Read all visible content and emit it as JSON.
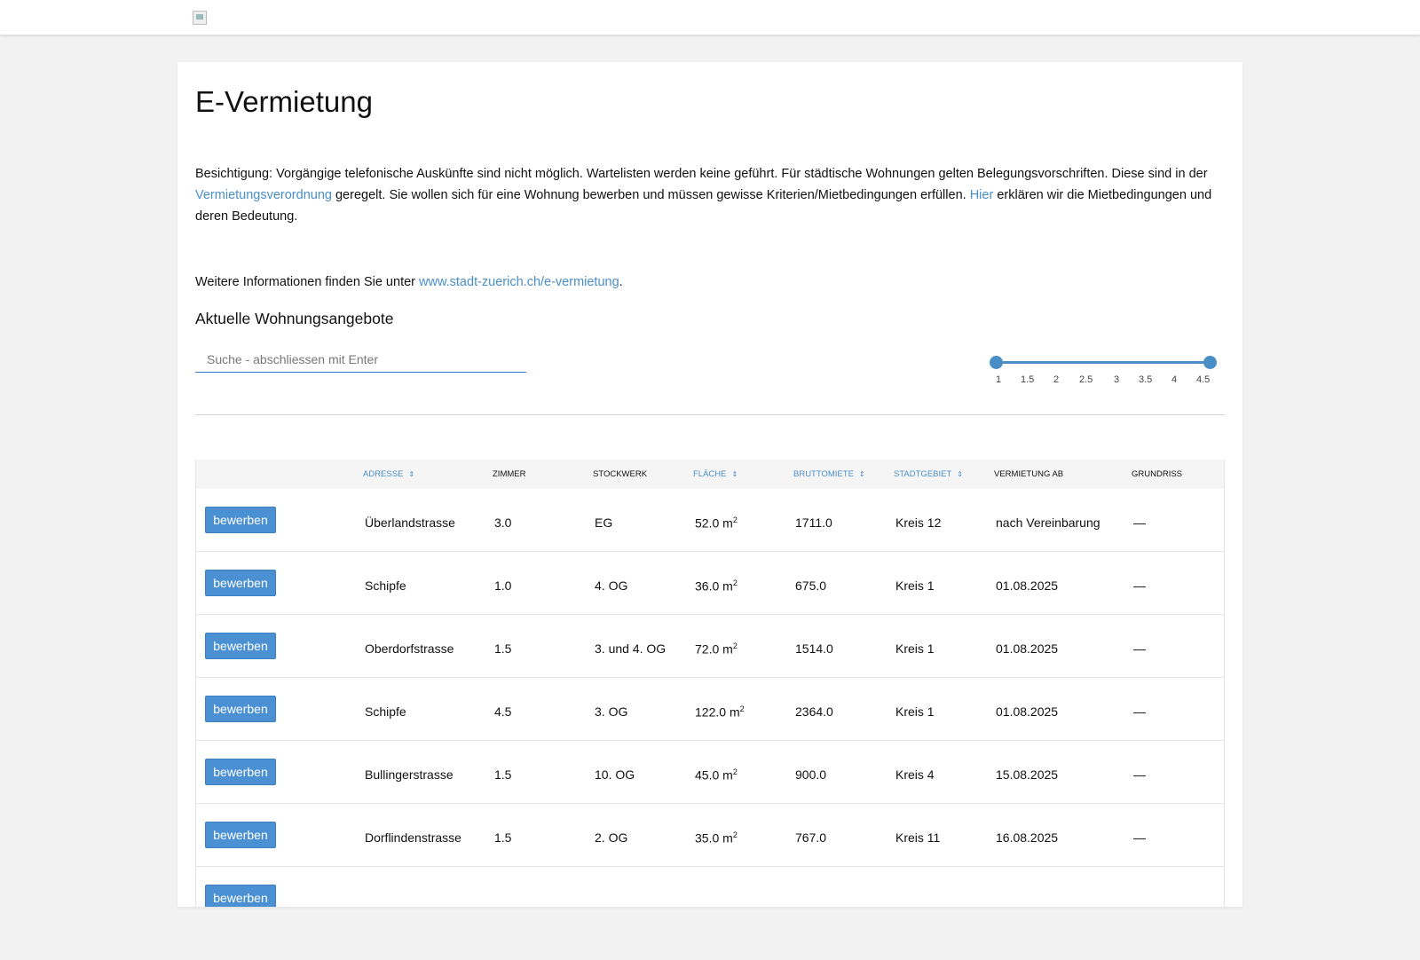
{
  "page": {
    "title": "E-Vermietung",
    "intro_part1": "Besichtigung: Vorgängige telefonische Auskünfte sind nicht möglich. Wartelisten werden keine geführt. Für städtische Wohnungen gelten Belegungsvorschriften. Diese sind in der ",
    "intro_link1": "Vermie­tungsverordnung",
    "intro_part2": " geregelt. Sie wollen sich für eine Wohnung bewerben und müssen gewisse Kriterien/Mietbedingungen erfüllen. ",
    "intro_link2": "Hier",
    "intro_part3": " erklären wir die Mietbedingungen und deren Bedeutung.",
    "more_prefix": "Weitere Informationen finden Sie unter ",
    "more_link": "www.stadt-zuerich.ch/e-vermietung",
    "more_suffix": ".",
    "offers_heading": "Aktuelle Wohnungsangebote"
  },
  "search": {
    "placeholder": "Suche - abschliessen mit Enter",
    "value": ""
  },
  "room_filter": {
    "min": "1",
    "max": "4.5",
    "ticks": [
      "1",
      "1.5",
      "2",
      "2.5",
      "3",
      "3.5",
      "4",
      "4.5"
    ]
  },
  "table": {
    "headers": {
      "adresse": "Adresse",
      "zimmer": "Zimmer",
      "stockwerk": "Stockwerk",
      "flaeche": "Fläche",
      "bruttomiete": "Bruttomiete",
      "stadtgebiet": "Stadtgebiet",
      "vermietung_ab": "Vermietung ab",
      "grundriss": "Grundriss"
    },
    "sort_icon": "⇕",
    "apply_label": "bewerben",
    "area_unit": "m",
    "area_exp": "2",
    "rows": [
      {
        "adresse": "Überlandstrasse",
        "zimmer": "3.0",
        "stockwerk": "EG",
        "flaeche": "52.0",
        "bruttomiete": "1711.0",
        "stadtgebiet": "Kreis 12",
        "vermietung_ab": "nach Vereinbarung",
        "grundriss": "—"
      },
      {
        "adresse": "Schipfe",
        "zimmer": "1.0",
        "stockwerk": "4. OG",
        "flaeche": "36.0",
        "bruttomiete": "675.0",
        "stadtgebiet": "Kreis 1",
        "vermietung_ab": "01.08.2025",
        "grundriss": "—"
      },
      {
        "adresse": "Oberdorfstrasse",
        "zimmer": "1.5",
        "stockwerk": "3. und 4. OG",
        "flaeche": "72.0",
        "bruttomiete": "1514.0",
        "stadtgebiet": "Kreis 1",
        "vermietung_ab": "01.08.2025",
        "grundriss": "—"
      },
      {
        "adresse": "Schipfe",
        "zimmer": "4.5",
        "stockwerk": "3. OG",
        "flaeche": "122.0",
        "bruttomiete": "2364.0",
        "stadtgebiet": "Kreis 1",
        "vermietung_ab": "01.08.2025",
        "grundriss": "—"
      },
      {
        "adresse": "Bullingerstrasse",
        "zimmer": "1.5",
        "stockwerk": "10. OG",
        "flaeche": "45.0",
        "bruttomiete": "900.0",
        "stadtgebiet": "Kreis 4",
        "vermietung_ab": "15.08.2025",
        "grundriss": "—"
      },
      {
        "adresse": "Dorflindenstrasse",
        "zimmer": "1.5",
        "stockwerk": "2. OG",
        "flaeche": "35.0",
        "bruttomiete": "767.0",
        "stadtgebiet": "Kreis 11",
        "vermietung_ab": "16.08.2025",
        "grundriss": "—"
      }
    ]
  }
}
